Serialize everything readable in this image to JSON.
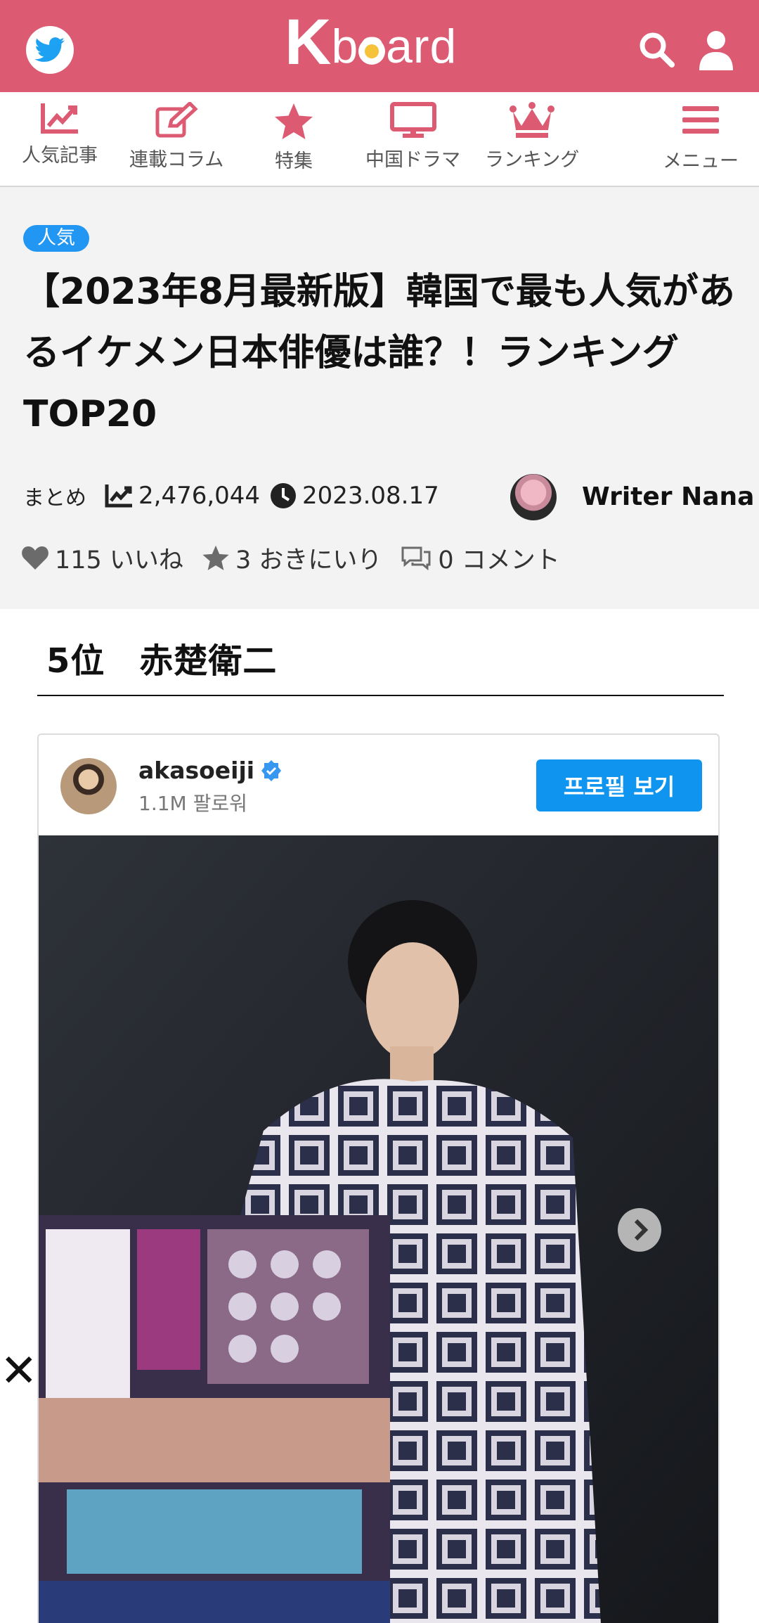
{
  "header": {
    "logo_k": "K",
    "logo_rest": "board",
    "colors": {
      "brand": "#dc5a72",
      "accent_blue": "#2196f3"
    },
    "icons": {
      "twitter": "twitter-icon",
      "search": "search-icon",
      "user": "user-icon"
    }
  },
  "nav": {
    "items": [
      {
        "label": "人気記事",
        "icon": "trending-chart-icon"
      },
      {
        "label": "連載コラム",
        "icon": "edit-icon"
      },
      {
        "label": "特集",
        "icon": "star-icon"
      },
      {
        "label": "中国ドラマ",
        "icon": "monitor-icon"
      },
      {
        "label": "ランキング",
        "icon": "crown-icon"
      },
      {
        "label": "メニュー",
        "icon": "hamburger-menu-icon"
      }
    ]
  },
  "article": {
    "tag": "人気",
    "title": "【2023年8月最新版】韓国で最も人気があるイケメン日本俳優は誰？！ランキングTOP20",
    "category": "まとめ",
    "views": "2,476,044",
    "date": "2023.08.17",
    "writer": "Writer Nana",
    "likes": "115 いいね",
    "favorites": "3 おきにいり",
    "comments": "0 コメント"
  },
  "section": {
    "heading": "5位　赤楚衛二"
  },
  "instagram": {
    "handle": "akasoeiji",
    "followers": "1.1M 팔로워",
    "profile_button": "프로필 보기"
  },
  "overlay": {
    "close": "✕"
  }
}
